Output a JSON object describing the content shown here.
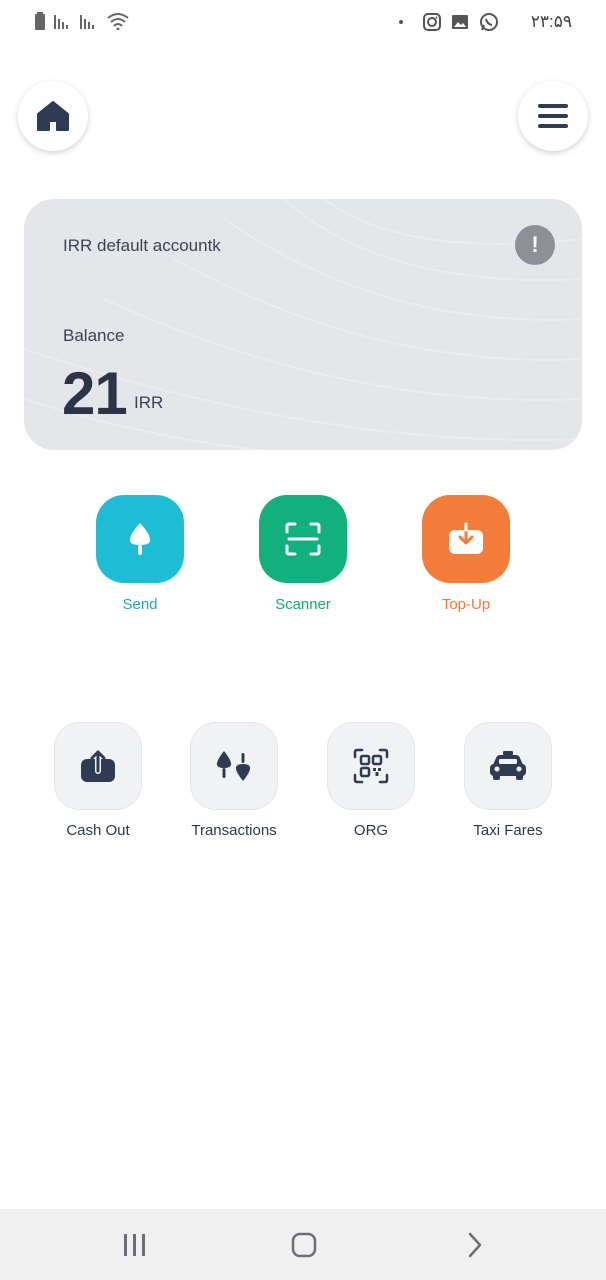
{
  "status_bar": {
    "time": "۲۳:۵۹",
    "left_icons": [
      "battery-icon",
      "signal-icon",
      "signal-icon",
      "wifi-icon"
    ],
    "right_icons": [
      "instagram-icon",
      "gallery-icon",
      "whatsapp-icon"
    ]
  },
  "header": {
    "left_button_icon": "home-icon",
    "right_button_icon": "menu-icon"
  },
  "account_card": {
    "account_name": "IRR default accountk",
    "info_icon": "!",
    "balance_label": "Balance",
    "balance_amount": "21",
    "currency": "IRR"
  },
  "primary_actions": [
    {
      "label": "Send",
      "icon": "send-icon",
      "color": "#1dbdd6"
    },
    {
      "label": "Scanner",
      "icon": "scanner-icon",
      "color": "#12b07d"
    },
    {
      "label": "Top-Up",
      "icon": "top-up-icon",
      "color": "#f57d3b"
    }
  ],
  "secondary_actions": [
    {
      "label": "Cash Out",
      "icon": "cash-out-icon"
    },
    {
      "label": "Transactions",
      "icon": "transactions-icon"
    },
    {
      "label": "ORG",
      "icon": "qr-code-icon"
    },
    {
      "label": "Taxi Fares",
      "icon": "taxi-icon"
    }
  ],
  "nav_bar": {
    "buttons": [
      "recent-apps-icon",
      "home-icon",
      "back-icon"
    ]
  }
}
